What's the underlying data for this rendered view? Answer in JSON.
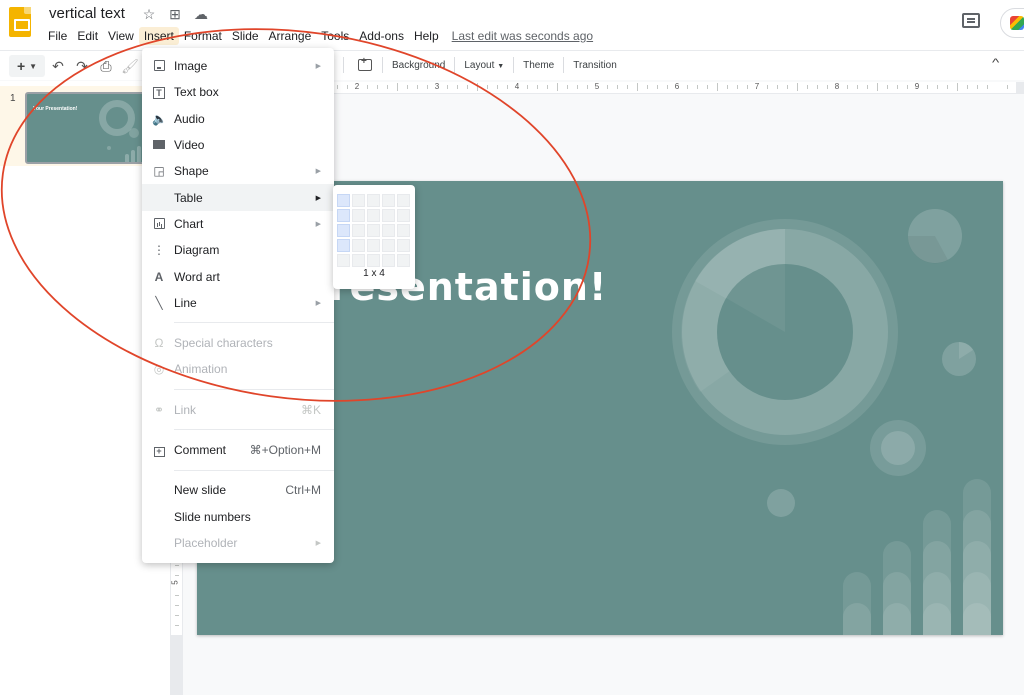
{
  "app": {
    "doc_title": "vertical text",
    "last_edit": "Last edit was seconds ago",
    "title_icons": [
      "star-icon",
      "move-to-folder-icon",
      "cloud-saved-icon"
    ]
  },
  "menubar": {
    "items": [
      "File",
      "Edit",
      "View",
      "Insert",
      "Format",
      "Slide",
      "Arrange",
      "Tools",
      "Add-ons",
      "Help"
    ],
    "active": "Insert"
  },
  "toolbar": {
    "left_icons": [
      "add-icon",
      "undo-icon",
      "redo-icon",
      "print-icon",
      "paint-format-icon"
    ],
    "buttons": {
      "background": "Background",
      "layout": "Layout",
      "theme": "Theme",
      "transition": "Transition"
    }
  },
  "ruler": {
    "horizontal_labels": [
      "2",
      "3",
      "4",
      "5",
      "6",
      "7",
      "8",
      "9"
    ],
    "vertical_labels": [
      "5"
    ]
  },
  "filmstrip": {
    "slides": [
      {
        "number": "1",
        "title": "Your Presentation!"
      }
    ]
  },
  "slide": {
    "title_visible": "Presentation!",
    "background_color": "#668f8c"
  },
  "insert_menu": {
    "items": [
      {
        "label": "Image",
        "icon": "image-icon",
        "submenu": true
      },
      {
        "label": "Text box",
        "icon": "text-box-icon"
      },
      {
        "label": "Audio",
        "icon": "audio-icon"
      },
      {
        "label": "Video",
        "icon": "video-icon"
      },
      {
        "label": "Shape",
        "icon": "shape-icon",
        "submenu": true
      },
      {
        "label": "Table",
        "icon": "",
        "submenu": true,
        "highlighted": true
      },
      {
        "label": "Chart",
        "icon": "chart-icon",
        "submenu": true
      },
      {
        "label": "Diagram",
        "icon": "diagram-icon"
      },
      {
        "label": "Word art",
        "icon": "word-art-icon"
      },
      {
        "label": "Line",
        "icon": "line-icon",
        "submenu": true
      },
      {
        "label": "Special characters",
        "icon": "omega-icon",
        "disabled": true
      },
      {
        "label": "Animation",
        "icon": "animation-icon",
        "disabled": true
      },
      {
        "label": "Link",
        "icon": "link-icon",
        "shortcut": "⌘K",
        "disabled": true
      },
      {
        "label": "Comment",
        "icon": "comment-add-icon",
        "shortcut": "⌘+Option+M"
      },
      {
        "label": "New slide",
        "shortcut": "Ctrl+M"
      },
      {
        "label": "Slide numbers"
      },
      {
        "label": "Placeholder",
        "submenu": true,
        "disabled": true
      }
    ]
  },
  "table_picker": {
    "columns": 5,
    "rows": 5,
    "selected_cols": 1,
    "selected_rows": 4,
    "label": "1 x 4"
  },
  "annotation": {
    "color": "#e0452a",
    "shape": "ellipse"
  }
}
